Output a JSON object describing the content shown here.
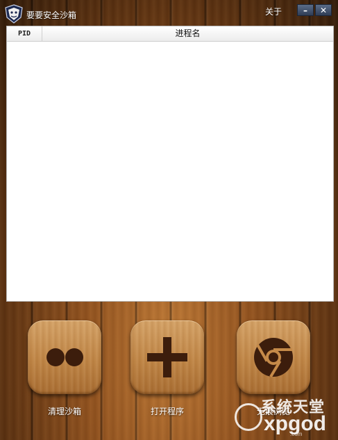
{
  "window": {
    "title": "要要安全沙箱",
    "about_label": "关于",
    "minimize_glyph": "–",
    "close_glyph": "✕"
  },
  "process_table": {
    "columns": [
      "PID",
      "进程名"
    ],
    "rows": []
  },
  "actions": [
    {
      "label": "清理沙箱",
      "icon": "two-dots-icon"
    },
    {
      "label": "打开程序",
      "icon": "plus-icon"
    },
    {
      "label": "无痕浏览",
      "icon": "browser-swirl-icon"
    }
  ],
  "watermark": {
    "text_cn": "系统天堂",
    "text_en": "xpgod",
    "text_small": ".com"
  },
  "colors": {
    "icon_dark": "#3c1d0c",
    "tile_wood": "#c68b4b",
    "background_wood": "#8a4c1d"
  }
}
